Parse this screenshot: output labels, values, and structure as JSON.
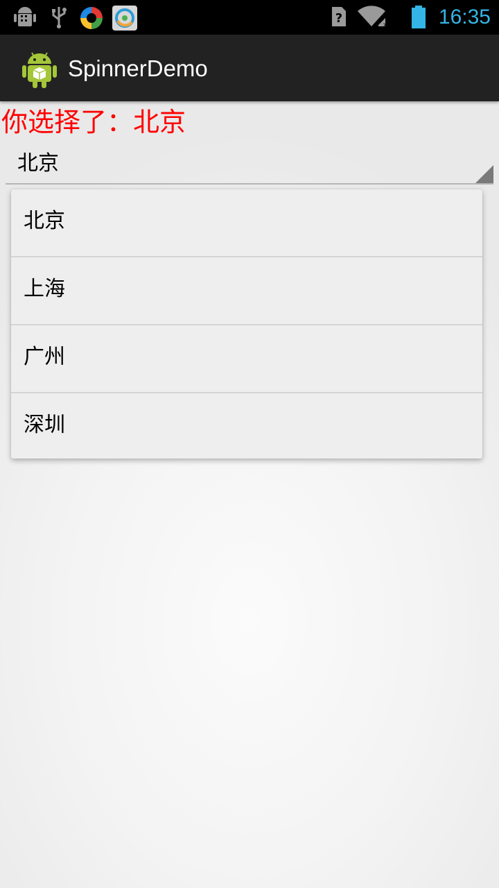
{
  "status_bar": {
    "time": "16:35",
    "icons": [
      "android-debug-icon",
      "usb-icon",
      "app-notification-icon",
      "browser-notification-icon",
      "sim-unknown-icon",
      "wifi-icon",
      "battery-icon"
    ]
  },
  "action_bar": {
    "title": "SpinnerDemo",
    "icon": "android-app-icon"
  },
  "content": {
    "selection_text": "你选择了：北京"
  },
  "spinner": {
    "selected_value": "北京",
    "options": [
      "北京",
      "上海",
      "广州",
      "深圳"
    ]
  },
  "colors": {
    "clock": "#33b5e5",
    "selection_text": "#ff0000",
    "action_bar": "#222222"
  }
}
